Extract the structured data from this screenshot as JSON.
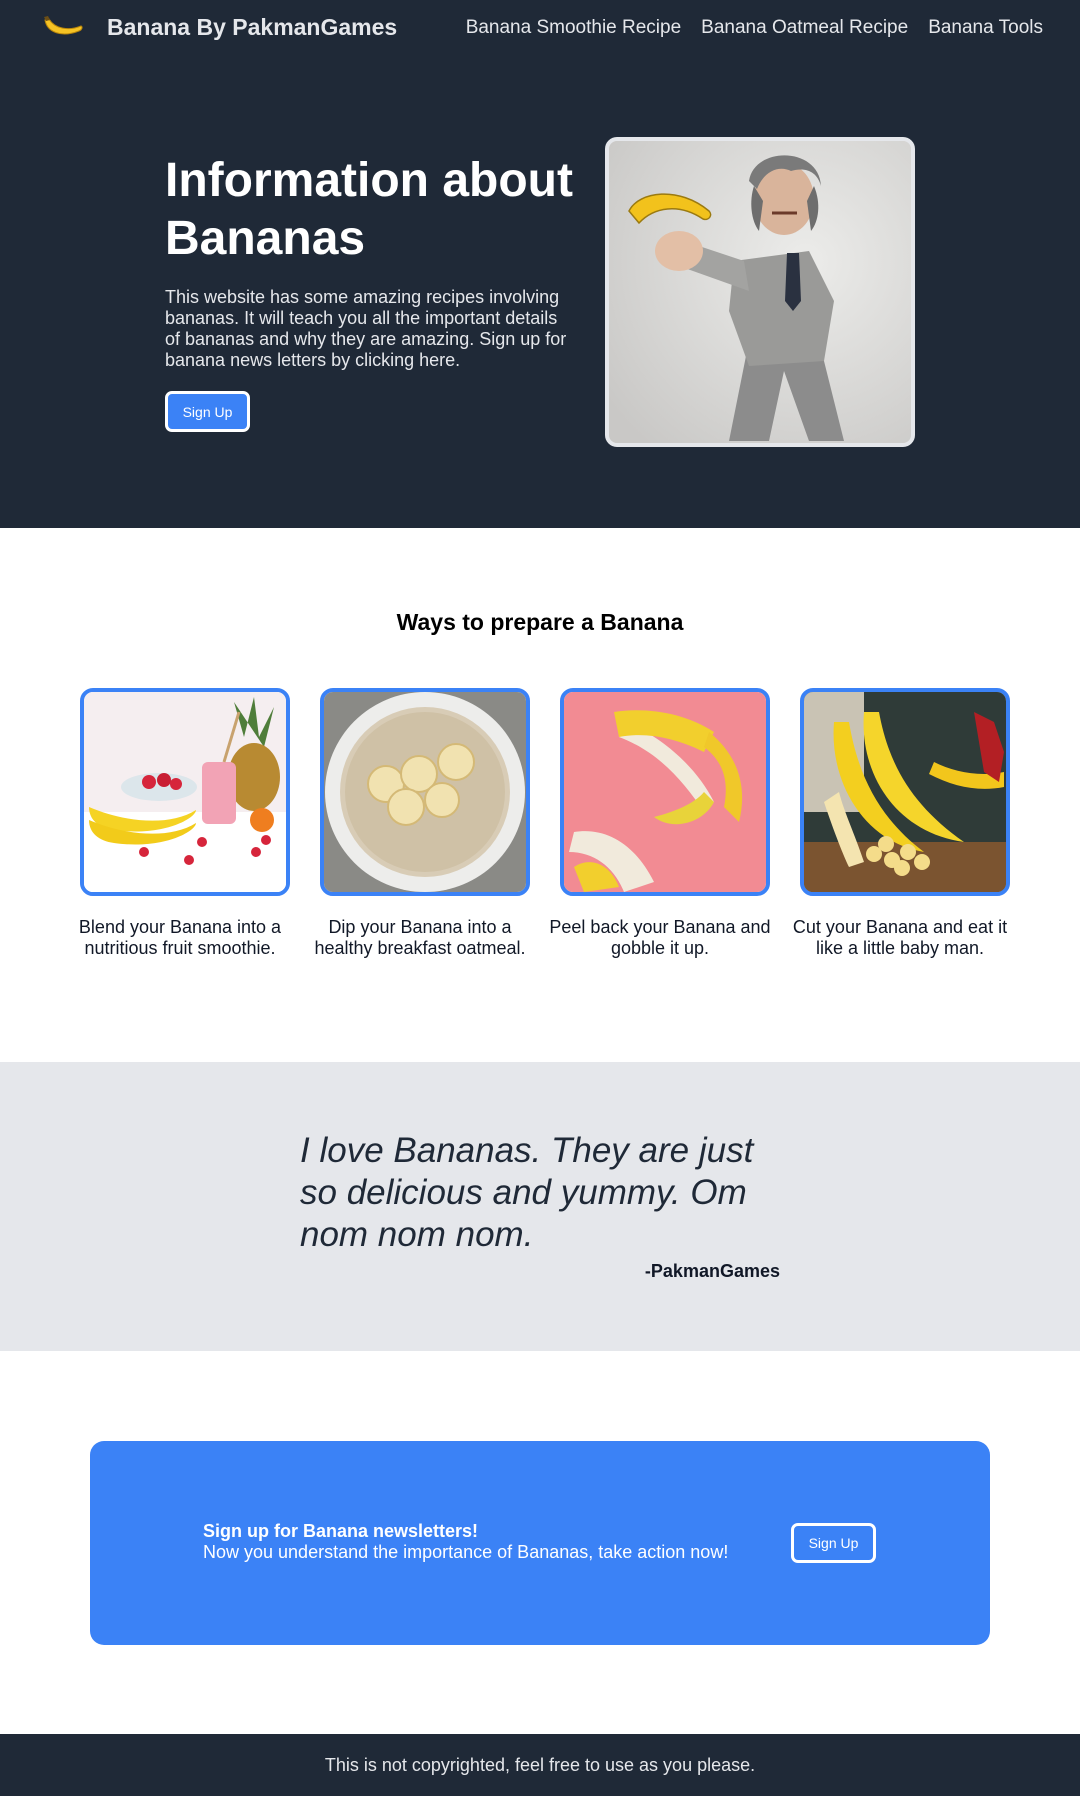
{
  "header": {
    "brand": "Banana By PakmanGames",
    "logo_icon": "banana-icon",
    "nav": [
      {
        "label": "Banana Smoothie Recipe"
      },
      {
        "label": "Banana Oatmeal Recipe"
      },
      {
        "label": "Banana Tools"
      }
    ]
  },
  "hero": {
    "title": "Information about Bananas",
    "text": "This website has some amazing recipes involving bananas. It will teach you all the important details of bananas and why they are amazing. Sign up for banana news letters by clicking here.",
    "button_label": "Sign Up",
    "image": "man-in-suit-holding-banana"
  },
  "ways": {
    "title": "Ways to prepare a Banana",
    "cards": [
      {
        "image": "banana-smoothie-photo",
        "caption": "Blend your Banana into a nutritious fruit smoothie."
      },
      {
        "image": "banana-oatmeal-photo",
        "caption": "Dip your Banana into a healthy breakfast oatmeal."
      },
      {
        "image": "peeled-banana-photo",
        "caption": "Peel back your Banana and gobble it up."
      },
      {
        "image": "sliced-banana-photo",
        "caption": "Cut your Banana and eat it like a little baby man."
      }
    ]
  },
  "quote": {
    "text": "I love Bananas. They are just so delicious and yummy. Om nom nom nom.",
    "author": "-PakmanGames"
  },
  "cta": {
    "heading": "Sign up for Banana newsletters!",
    "subtext": "Now you understand the importance of Bananas, take action now!",
    "button_label": "Sign Up"
  },
  "footer": {
    "text": "This is not copyrighted, feel free to use as you please."
  },
  "colors": {
    "dark": "#1f2937",
    "accent": "#3b82f6",
    "light_gray": "#e5e7eb"
  }
}
